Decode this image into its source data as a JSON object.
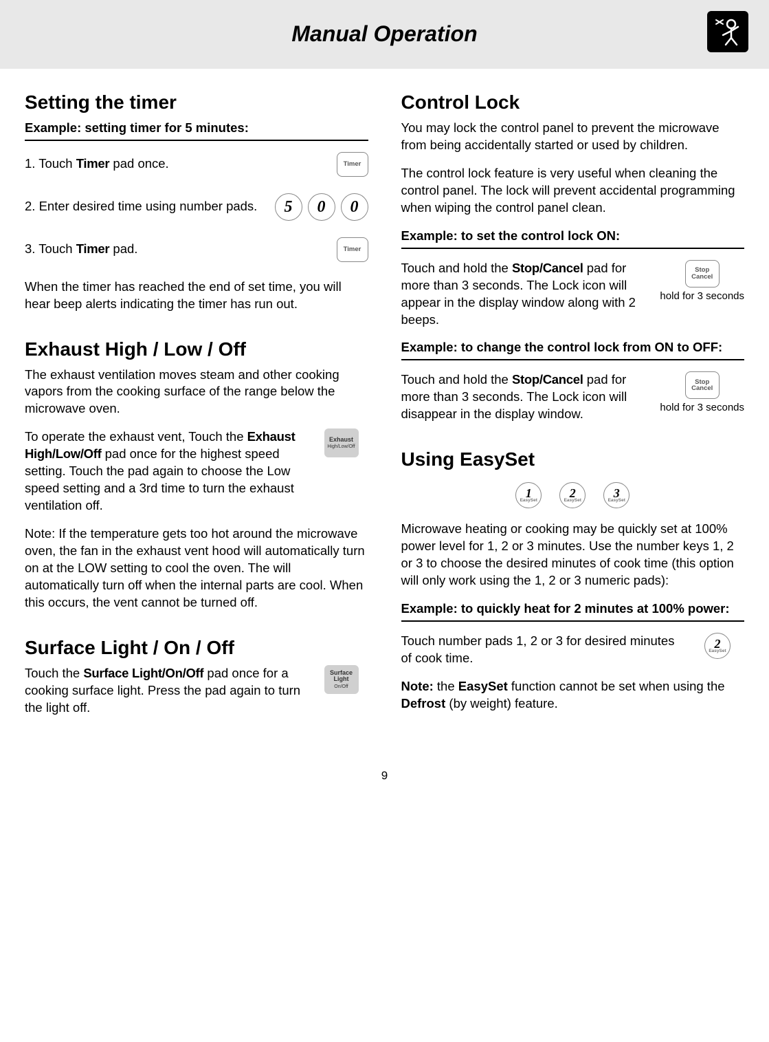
{
  "header": {
    "title": "Manual Operation"
  },
  "left": {
    "timer": {
      "heading": "Setting the timer",
      "example": "Example: setting timer for 5 minutes:",
      "step1_pre": "1.  Touch ",
      "step1_bold": "Timer",
      "step1_post": " pad once.",
      "timer_btn": "Timer",
      "step2": "2.  Enter desired time using number pads.",
      "digits": [
        "5",
        "0",
        "0"
      ],
      "step3_pre": "3.  Touch ",
      "step3_bold": "Timer",
      "step3_post": " pad.",
      "after": "When the timer has reached the end of set time, you will hear beep alerts indicating the timer has run out."
    },
    "exhaust": {
      "heading": "Exhaust High / Low / Off",
      "p1": "The exhaust ventilation moves steam and other cooking vapors from the cooking surface of the range below the microwave oven.",
      "p2_pre": "To operate the exhaust vent, Touch the ",
      "p2_bold": "Exhaust High/Low/Off",
      "p2_post": " pad once for the highest speed setting. Touch the pad again to choose the Low speed setting and a 3rd time to turn the exhaust ventilation off.",
      "btn_l1": "Exhaust",
      "btn_l2": "High/Low/Off",
      "note": "Note: If the temperature gets too hot around the microwave oven, the fan in the exhaust vent hood will automatically turn on at the LOW setting to cool the oven. The will automatically turn off when the internal parts are cool. When this occurs, the vent cannot be turned off."
    },
    "surface": {
      "heading": "Surface Light / On / Off",
      "p_pre": "Touch the ",
      "p_bold": "Surface Light/On/Off",
      "p_post": " pad once for a cooking surface light. Press the pad again to turn the light off.",
      "btn_l1": "Surface",
      "btn_l2": "Light",
      "btn_l3": "On/Off"
    }
  },
  "right": {
    "lock": {
      "heading": "Control Lock",
      "p1": "You may lock the control panel to prevent the microwave from being accidentally started or used by children.",
      "p2": "The control lock feature is very useful when cleaning the control panel. The lock will prevent accidental programming when wiping the control panel clean.",
      "ex_on": "Example: to set the control lock ON:",
      "on_text_pre": "Touch and hold the ",
      "on_text_bold": "Stop/Cancel",
      "on_text_post": " pad for more than 3 seconds. The Lock icon will appear in the display window along with 2 beeps.",
      "stop_l1": "Stop",
      "stop_l2": "Cancel",
      "hold_caption": "hold for 3 seconds",
      "ex_off": "Example: to change the control lock from ON to OFF:",
      "off_text_pre": "Touch and hold the ",
      "off_text_bold": "Stop/Cancel",
      "off_text_post": " pad for more than 3 seconds. The Lock icon will disappear in the display window."
    },
    "easyset": {
      "heading": "Using EasySet",
      "pads": [
        "1",
        "2",
        "3"
      ],
      "pad_sub": "EasySet",
      "p1": "Microwave heating or cooking may be quickly set at 100% power level for 1, 2 or 3 minutes. Use the number keys  1, 2 or 3 to choose the desired minutes of cook time (this option will only work using the 1, 2 or 3 numeric pads):",
      "ex": "Example: to quickly heat for 2 minutes at 100% power:",
      "quick_text": "Touch number pads 1, 2 or 3 for desired minutes of cook time.",
      "quick_pad": "2",
      "note_pre": "Note: ",
      "note_mid1": "the ",
      "note_b1": "EasySet",
      "note_mid2": " function cannot be set when using the ",
      "note_b2": "Defrost",
      "note_post": " (by weight) feature."
    }
  },
  "page": "9"
}
